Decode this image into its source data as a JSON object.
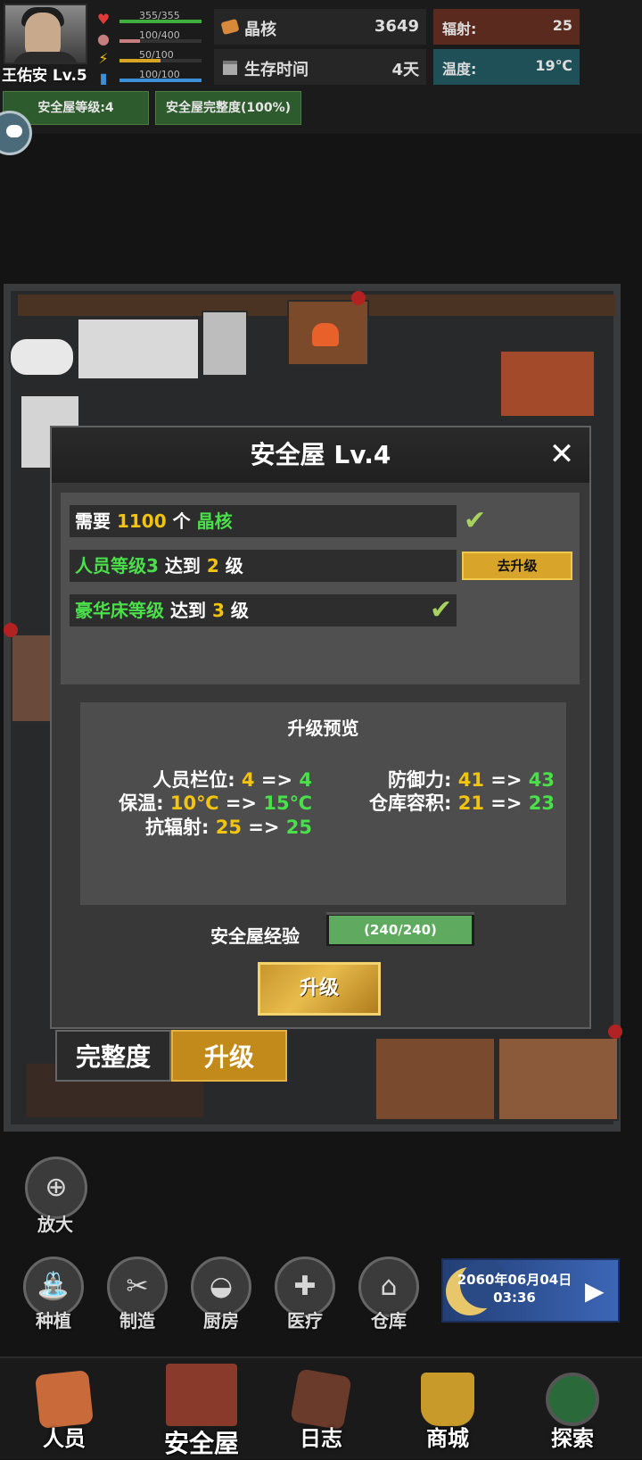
{
  "player": {
    "name": "王佑安 Lv.5"
  },
  "stats": [
    {
      "icon": "heart-icon",
      "value": "355/355",
      "color": "#3fae3f",
      "fraction": 1.0
    },
    {
      "icon": "stomach-icon",
      "value": "100/400",
      "color": "#c77e7e",
      "fraction": 0.25
    },
    {
      "icon": "energy-icon",
      "value": "50/100",
      "color": "#d9a526",
      "fraction": 0.5
    },
    {
      "icon": "water-icon",
      "value": "100/100",
      "color": "#3a8fd6",
      "fraction": 1.0
    }
  ],
  "resources": {
    "crystal": {
      "label": "晶核",
      "value": "3649"
    },
    "survival": {
      "label": "生存时间",
      "value": "4天"
    },
    "radiation": {
      "label": "辐射:",
      "value": "25"
    },
    "temperature": {
      "label": "温度:",
      "value": "19℃"
    }
  },
  "tags": {
    "level": "安全屋等级:4",
    "integrity": "安全屋完整度(100%)"
  },
  "tabs": {
    "integrity": "完整度",
    "upgrade": "升级"
  },
  "dialog": {
    "title": "安全屋 Lv.4",
    "requirements": [
      {
        "p1": "需要 ",
        "p2": "1100",
        "p3": " 个 ",
        "p4": "晶核",
        "done": true
      },
      {
        "p1": "人员等级3",
        "p2": " 达到 ",
        "p3": "2",
        "p4": " 级",
        "done": false
      },
      {
        "p1": "豪华床等级",
        "p2": " 达到 ",
        "p3": "3",
        "p4": " 级",
        "done": true
      }
    ],
    "go_upgrade": "去升级",
    "preview": {
      "title": "升级预览",
      "left": [
        {
          "label": "人员栏位:",
          "from": "4",
          "to": "4"
        },
        {
          "label": "保温:",
          "from": "10℃",
          "to": "15℃"
        },
        {
          "label": "抗辐射:",
          "from": "25",
          "to": "25"
        }
      ],
      "right": [
        {
          "label": "防御力:",
          "from": "41",
          "to": "43"
        },
        {
          "label": "仓库容积:",
          "from": "21",
          "to": "23"
        }
      ],
      "arrow": "=>"
    },
    "exp_label": "安全屋经验",
    "exp_value": "(240/240)",
    "upgrade_button": "升级"
  },
  "zoom": {
    "label": "放大"
  },
  "actions": [
    {
      "label": "种植",
      "icon": "watering-can-icon",
      "glyph": "⛲"
    },
    {
      "label": "制造",
      "icon": "tools-icon",
      "glyph": "✂"
    },
    {
      "label": "厨房",
      "icon": "pot-icon",
      "glyph": "◒"
    },
    {
      "label": "医疗",
      "icon": "medical-cross-icon",
      "glyph": "✚"
    },
    {
      "label": "仓库",
      "icon": "warehouse-icon",
      "glyph": "⌂"
    }
  ],
  "datetime": {
    "date": "2060年06月04日",
    "time": "03:36"
  },
  "nav": [
    {
      "label": "人员",
      "icon": "id-card-icon"
    },
    {
      "label": "安全屋",
      "icon": "house-icon"
    },
    {
      "label": "日志",
      "icon": "journal-icon"
    },
    {
      "label": "商城",
      "icon": "basket-icon"
    },
    {
      "label": "探索",
      "icon": "radar-icon"
    }
  ]
}
